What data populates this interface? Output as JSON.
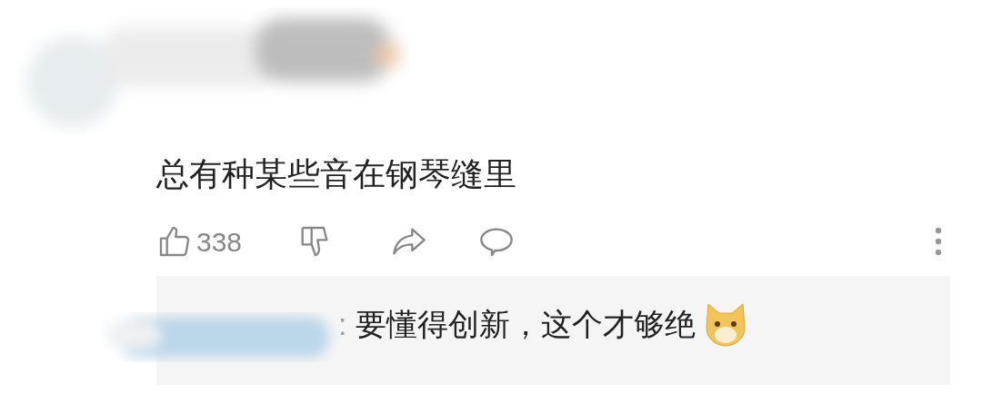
{
  "comment": {
    "text": "总有种某些音在钢琴缝里",
    "likes": "338",
    "reply": {
      "separator": ":",
      "text": "要懂得创新，这个才够绝"
    }
  }
}
